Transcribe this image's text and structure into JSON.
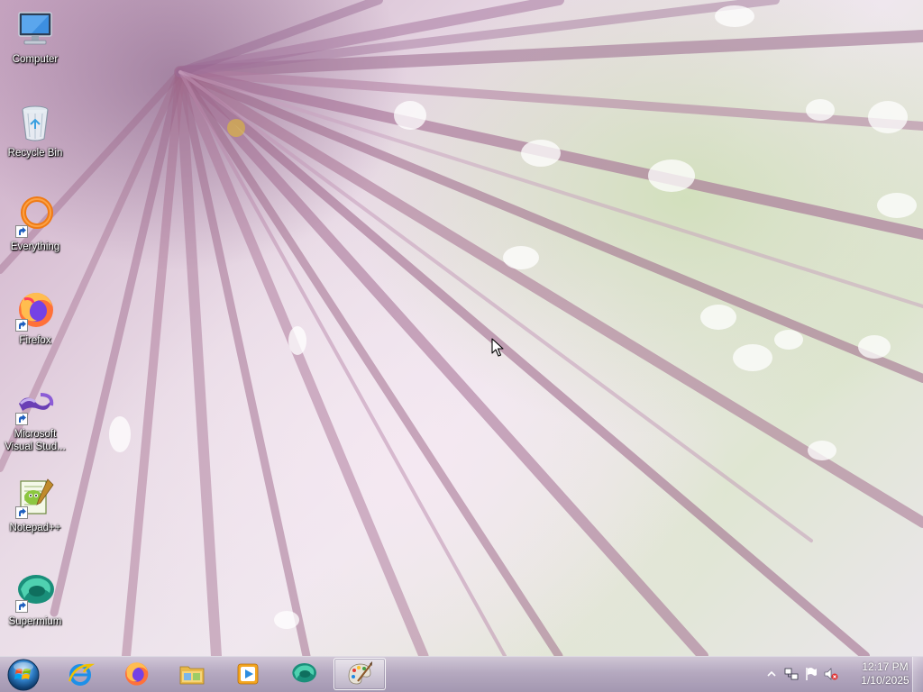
{
  "desktop_icons": [
    {
      "label": "Computer",
      "icon": "computer-icon"
    },
    {
      "label": "Recycle Bin",
      "icon": "recycle-bin-icon"
    },
    {
      "label": "Everything",
      "icon": "everything-search-icon"
    },
    {
      "label": "Firefox",
      "icon": "firefox-icon"
    },
    {
      "label": "Microsoft Visual Stud...",
      "icon": "visual-studio-icon"
    },
    {
      "label": "Notepad++",
      "icon": "notepad-plus-plus-icon"
    },
    {
      "label": "Supermium",
      "icon": "supermium-icon"
    }
  ],
  "taskbar": {
    "start_icon": "windows-start-orb-icon",
    "pinned": [
      {
        "icon": "internet-explorer-icon"
      },
      {
        "icon": "firefox-icon"
      },
      {
        "icon": "file-explorer-icon"
      },
      {
        "icon": "media-player-icon"
      },
      {
        "icon": "supermium-icon"
      },
      {
        "icon": "paint-icon",
        "active": true
      }
    ]
  },
  "tray": {
    "icons": [
      "show-hidden-icons-chevron-icon",
      "network-icon",
      "action-center-flag-icon",
      "volume-muted-icon"
    ],
    "time": "12:17 PM",
    "date": "1/10/2025"
  },
  "colors": {
    "wallpaper_pink": "#c9a7c3",
    "wallpaper_green": "#cddeb4",
    "taskbar_tint": "#b2a5be",
    "label_text": "#ffffff"
  }
}
